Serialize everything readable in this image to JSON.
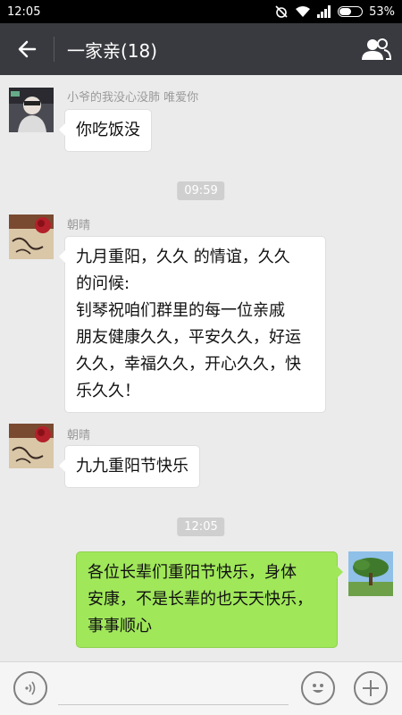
{
  "status_bar": {
    "time": "12:05",
    "battery": "53%",
    "battery_level": 0.53,
    "icons": [
      "alarm-off-icon",
      "wifi-icon",
      "signal-icon",
      "battery-icon"
    ]
  },
  "header": {
    "title": "一家亲(18)",
    "back_icon": "back-arrow-icon",
    "members_icon": "group-members-icon",
    "background": "#393a3f"
  },
  "messages": [
    {
      "type": "incoming",
      "sender": "小爷的我没心没肺  唯爱你",
      "avatar": "avatar-boy",
      "text": "你吃饭没"
    },
    {
      "type": "time",
      "text": "09:59"
    },
    {
      "type": "incoming",
      "sender": "朝晴",
      "avatar": "avatar-rose",
      "lines": [
        "九月重阳，久久 的情谊，久久",
        "的问候:",
        "钊琴祝咱们群里的每一位亲戚",
        "朋友健康久久，平安久久，好运",
        "久久，幸福久久，开心久久，快",
        "乐久久！"
      ]
    },
    {
      "type": "incoming",
      "sender": "朝晴",
      "avatar": "avatar-rose",
      "text": "九九重阳节快乐"
    },
    {
      "type": "time",
      "text": "12:05"
    },
    {
      "type": "outgoing",
      "avatar": "avatar-tree",
      "lines": [
        "各位长辈们重阳节快乐，身体",
        "安康，不是长辈的也天天快乐，",
        "事事顺心"
      ]
    }
  ],
  "input_bar": {
    "voice_icon": "voice-icon",
    "emoji_icon": "emoji-icon",
    "plus_icon": "plus-icon"
  },
  "colors": {
    "chat_bg": "#ebebeb",
    "outgoing_bubble": "#a0e75a",
    "incoming_bubble": "#ffffff",
    "timestamp_bg": "#cfcfcf"
  }
}
